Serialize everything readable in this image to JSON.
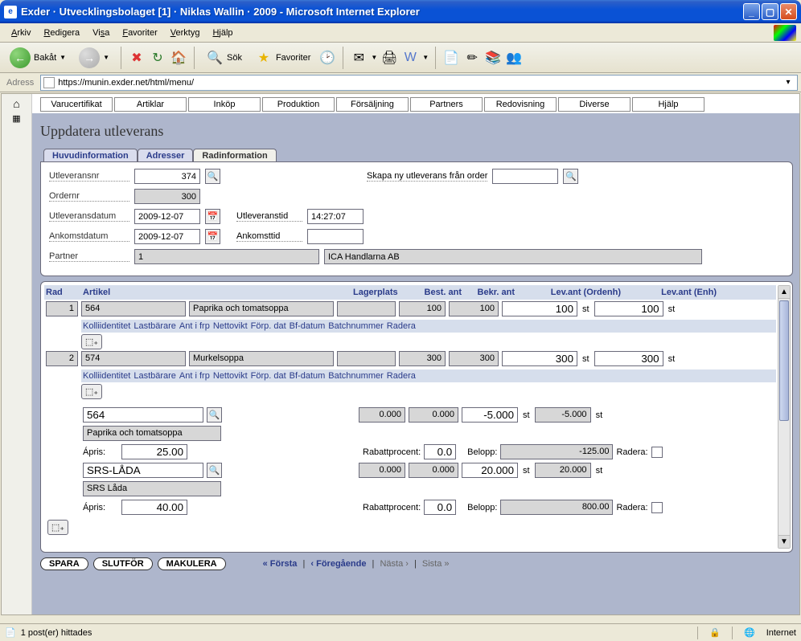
{
  "window": {
    "title": "Exder · Utvecklingsbolaget [1] · Niklas Wallin · 2009 - Microsoft Internet Explorer"
  },
  "ie_menu": {
    "arkiv": "Arkiv",
    "redigera": "Redigera",
    "visa": "Visa",
    "favoriter": "Favoriter",
    "verktyg": "Verktyg",
    "hjalp": "Hjälp"
  },
  "ie_toolbar": {
    "back": "Bakåt",
    "search": "Sök",
    "favorites": "Favoriter"
  },
  "ie_addr": {
    "label": "Adress",
    "url": "https://munin.exder.net/html/menu/"
  },
  "app_menu": {
    "varucertifikat": "Varucertifikat",
    "artiklar": "Artiklar",
    "inkop": "Inköp",
    "produktion": "Produktion",
    "forsaljning": "Försäljning",
    "partners": "Partners",
    "redovisning": "Redovisning",
    "diverse": "Diverse",
    "hjalp": "Hjälp"
  },
  "page": {
    "title": "Uppdatera utleverans"
  },
  "tabs": {
    "huvudinformation": "Huvudinformation",
    "adresser": "Adresser",
    "radinformation": "Radinformation"
  },
  "form": {
    "utleveransnr_lbl": "Utleveransnr",
    "utleveransnr_val": "374",
    "skapa_lbl": "Skapa ny utleverans från order",
    "skapa_val": "",
    "ordernr_lbl": "Ordernr",
    "ordernr_val": "300",
    "utlevdatum_lbl": "Utleveransdatum",
    "utlevdatum_val": "2009-12-07",
    "utlevtid_lbl": "Utleveranstid",
    "utlevtid_val": "14:27:07",
    "ankdatum_lbl": "Ankomstdatum",
    "ankdatum_val": "2009-12-07",
    "anktid_lbl": "Ankomsttid",
    "anktid_val": "",
    "partner_lbl": "Partner",
    "partner_id": "1",
    "partner_name": "ICA Handlarna AB"
  },
  "hdr": {
    "rad": "Rad",
    "artikel": "Artikel",
    "lagerplats": "Lagerplats",
    "best_ant": "Best. ant",
    "bekr_ant": "Bekr. ant",
    "lev_ordenh": "Lev.ant (Ordenh)",
    "lev_enh": "Lev.ant (Enh)"
  },
  "rows": [
    {
      "rn": "1",
      "art": "564",
      "desc": "Paprika och tomatsoppa",
      "lp": "",
      "best": "100",
      "bekr": "100",
      "lo": "100",
      "lo_u": "st",
      "le": "100",
      "le_u": "st"
    },
    {
      "rn": "2",
      "art": "574",
      "desc": "Murkelsoppa",
      "lp": "",
      "best": "300",
      "bekr": "300",
      "lo": "300",
      "lo_u": "st",
      "le": "300",
      "le_u": "st"
    }
  ],
  "subhdr": {
    "kolli": "Kolliidentitet",
    "lastb": "Lastbärare",
    "antfrp": "Ant i frp",
    "netto": "Nettovikt",
    "forp": "Förp. dat",
    "bf": "Bf-datum",
    "batch": "Batchnummer",
    "radera": "Radera"
  },
  "extra": [
    {
      "art": "564",
      "desc": "Paprika och tomatsoppa",
      "q1": "0.000",
      "q2": "0.000",
      "lo": "-5.000",
      "lo_u": "st",
      "le": "-5.000",
      "le_u": "st",
      "apris_lbl": "Ápris:",
      "apris": "25.00",
      "rabatt_lbl": "Rabattprocent:",
      "rabatt": "0.0",
      "belopp_lbl": "Belopp:",
      "belopp": "-125.00",
      "radera_lbl": "Radera:"
    },
    {
      "art": "SRS-LÅDA",
      "desc": "SRS Låda",
      "q1": "0.000",
      "q2": "0.000",
      "lo": "20.000",
      "lo_u": "st",
      "le": "20.000",
      "le_u": "st",
      "apris_lbl": "Ápris:",
      "apris": "40.00",
      "rabatt_lbl": "Rabattprocent:",
      "rabatt": "0.0",
      "belopp_lbl": "Belopp:",
      "belopp": "800.00",
      "radera_lbl": "Radera:"
    }
  ],
  "footer": {
    "spara": "SPARA",
    "slutfor": "SLUTFÖR",
    "makulera": "MAKULERA",
    "forsta": "« Första",
    "foregaende": "‹ Föregående",
    "nasta": "Nästa ›",
    "sista": "Sista »"
  },
  "status": {
    "left": "1 post(er) hittades",
    "zone": "Internet"
  }
}
